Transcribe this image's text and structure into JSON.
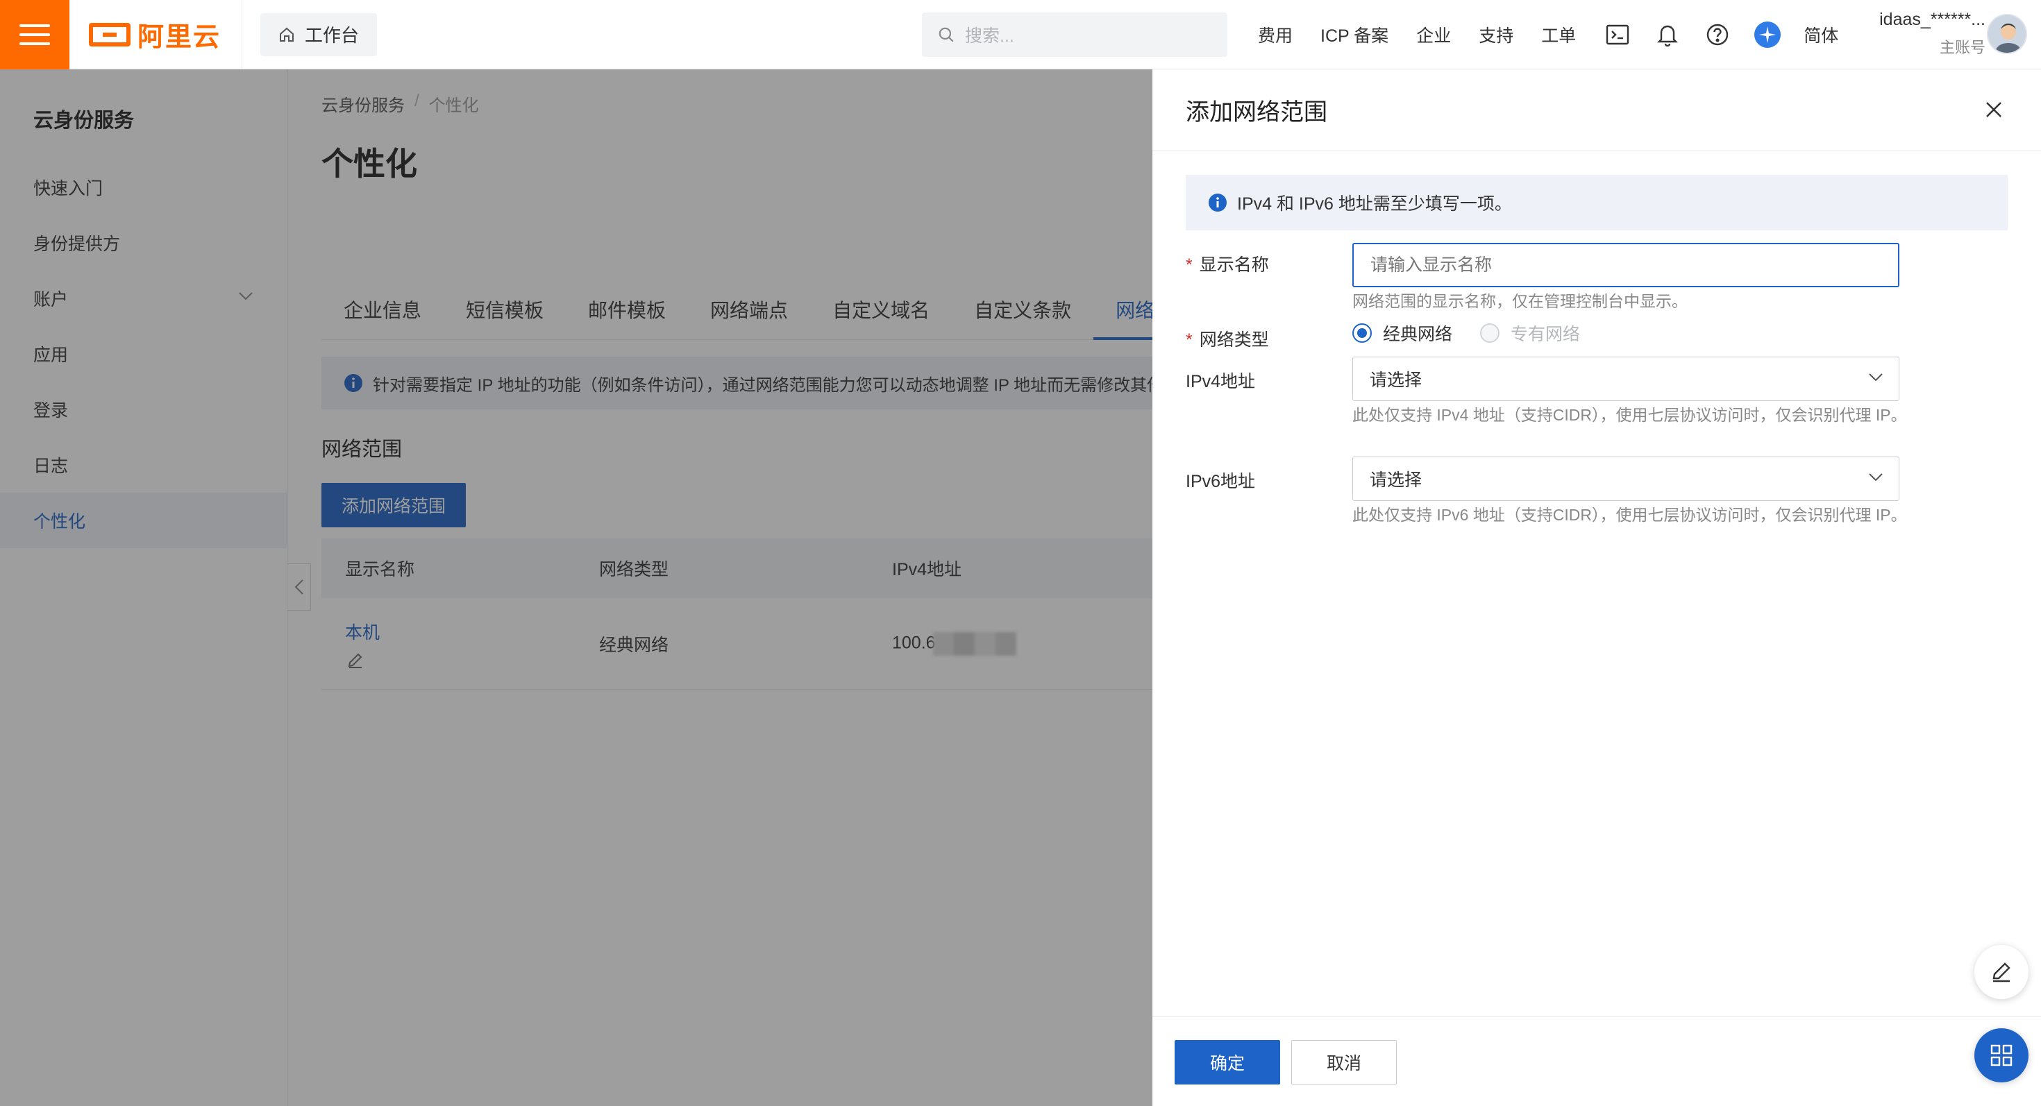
{
  "topbar": {
    "logo_text": "阿里云",
    "workbench_label": "工作台",
    "search_placeholder": "搜索...",
    "nav_links": [
      "费用",
      "ICP 备案",
      "企业",
      "支持",
      "工单"
    ],
    "lang_label": "简体",
    "user_name": "idaas_******...",
    "user_role": "主账号",
    "brand_color": "#ff6a00",
    "icons": [
      "terminal-icon",
      "bell-icon",
      "help-icon",
      "ai-assistant-icon"
    ]
  },
  "sidebar": {
    "title": "云身份服务",
    "items": [
      {
        "label": "快速入门"
      },
      {
        "label": "身份提供方"
      },
      {
        "label": "账户"
      },
      {
        "label": "应用"
      },
      {
        "label": "登录"
      },
      {
        "label": "日志"
      },
      {
        "label": "个性化"
      }
    ]
  },
  "main": {
    "breadcrumb": [
      "云身份服务",
      "个性化"
    ],
    "breadcrumb_sep": "/",
    "title": "个性化",
    "tabs": [
      "企业信息",
      "短信模板",
      "邮件模板",
      "网络端点",
      "自定义域名",
      "自定义条款",
      "网络"
    ],
    "info_text": "针对需要指定 IP 地址的功能（例如条件访问），通过网络范围能力您可以动态地调整 IP 地址而无需修改其他",
    "section_title": "网络范围",
    "add_button": "添加网络范围",
    "table": {
      "headers": [
        "显示名称",
        "网络类型",
        "IPv4地址"
      ],
      "rows": [
        {
          "name": "本机",
          "type": "经典网络",
          "ipv4": "100.6"
        }
      ]
    }
  },
  "drawer": {
    "title": "添加网络范围",
    "notice": "IPv4 和 IPv6 地址需至少填写一项。",
    "required_mark": "*",
    "name_label": "显示名称",
    "name_placeholder": "请输入显示名称",
    "name_help": "网络范围的显示名称，仅在管理控制台中显示。",
    "type_label": "网络类型",
    "type_options": [
      "经典网络",
      "专有网络"
    ],
    "type_selected": "经典网络",
    "ipv4_label": "IPv4地址",
    "ipv4_placeholder": "请选择",
    "ipv4_help": "此处仅支持 IPv4 地址（支持CIDR），使用七层协议访问时，仅会识别代理 IP。",
    "ipv6_label": "IPv6地址",
    "ipv6_placeholder": "请选择",
    "ipv6_help": "此处仅支持 IPv6 地址（支持CIDR），使用七层协议访问时，仅会识别代理 IP。",
    "confirm": "确定",
    "cancel": "取消"
  },
  "colors": {
    "primary": "#1e63c7",
    "required": "#d93026"
  }
}
